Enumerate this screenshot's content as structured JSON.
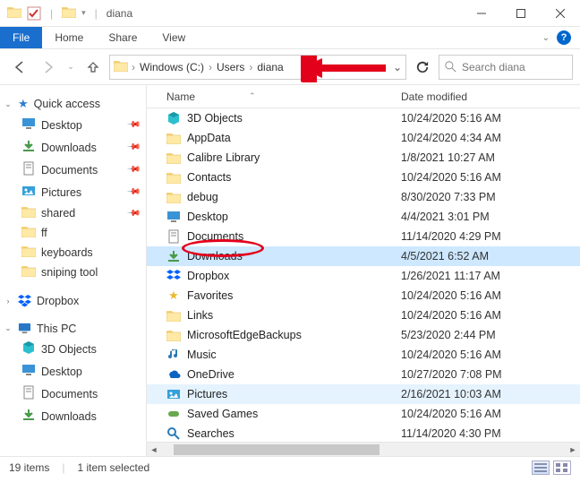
{
  "title": "diana",
  "ribbon": {
    "file": "File",
    "tabs": [
      "Home",
      "Share",
      "View"
    ]
  },
  "breadcrumb": [
    "Windows (C:)",
    "Users",
    "diana"
  ],
  "search": {
    "placeholder": "Search diana"
  },
  "sidebar": {
    "quick_access": {
      "label": "Quick access",
      "items": [
        {
          "label": "Desktop",
          "pinned": true
        },
        {
          "label": "Downloads",
          "pinned": true
        },
        {
          "label": "Documents",
          "pinned": true
        },
        {
          "label": "Pictures",
          "pinned": true
        },
        {
          "label": "shared",
          "pinned": true
        },
        {
          "label": "ff",
          "pinned": false
        },
        {
          "label": "keyboards",
          "pinned": false
        },
        {
          "label": "sniping tool",
          "pinned": false
        }
      ]
    },
    "dropbox": {
      "label": "Dropbox"
    },
    "this_pc": {
      "label": "This PC",
      "items": [
        {
          "label": "3D Objects"
        },
        {
          "label": "Desktop"
        },
        {
          "label": "Documents"
        },
        {
          "label": "Downloads"
        }
      ]
    }
  },
  "columns": {
    "name": "Name",
    "date": "Date modified"
  },
  "rows": [
    {
      "name": "3D Objects",
      "date": "10/24/2020 5:16 AM",
      "icon": "3d"
    },
    {
      "name": "AppData",
      "date": "10/24/2020 4:34 AM",
      "icon": "folder"
    },
    {
      "name": "Calibre Library",
      "date": "1/8/2021 10:27 AM",
      "icon": "folder"
    },
    {
      "name": "Contacts",
      "date": "10/24/2020 5:16 AM",
      "icon": "folder"
    },
    {
      "name": "debug",
      "date": "8/30/2020 7:33 PM",
      "icon": "folder"
    },
    {
      "name": "Desktop",
      "date": "4/4/2021 3:01 PM",
      "icon": "desktop"
    },
    {
      "name": "Documents",
      "date": "11/14/2020 4:29 PM",
      "icon": "docs"
    },
    {
      "name": "Downloads",
      "date": "4/5/2021 6:52 AM",
      "icon": "downloads",
      "selected": true
    },
    {
      "name": "Dropbox",
      "date": "1/26/2021 11:17 AM",
      "icon": "dropbox"
    },
    {
      "name": "Favorites",
      "date": "10/24/2020 5:16 AM",
      "icon": "fav"
    },
    {
      "name": "Links",
      "date": "10/24/2020 5:16 AM",
      "icon": "folder"
    },
    {
      "name": "MicrosoftEdgeBackups",
      "date": "5/23/2020 2:44 PM",
      "icon": "folder"
    },
    {
      "name": "Music",
      "date": "10/24/2020 5:16 AM",
      "icon": "music"
    },
    {
      "name": "OneDrive",
      "date": "10/27/2020 7:08 PM",
      "icon": "onedrive"
    },
    {
      "name": "Pictures",
      "date": "2/16/2021 10:03 AM",
      "icon": "pictures",
      "highlight": true
    },
    {
      "name": "Saved Games",
      "date": "10/24/2020 5:16 AM",
      "icon": "games"
    },
    {
      "name": "Searches",
      "date": "11/14/2020 4:30 PM",
      "icon": "search"
    }
  ],
  "status": {
    "items": "19 items",
    "selected": "1 item selected"
  }
}
